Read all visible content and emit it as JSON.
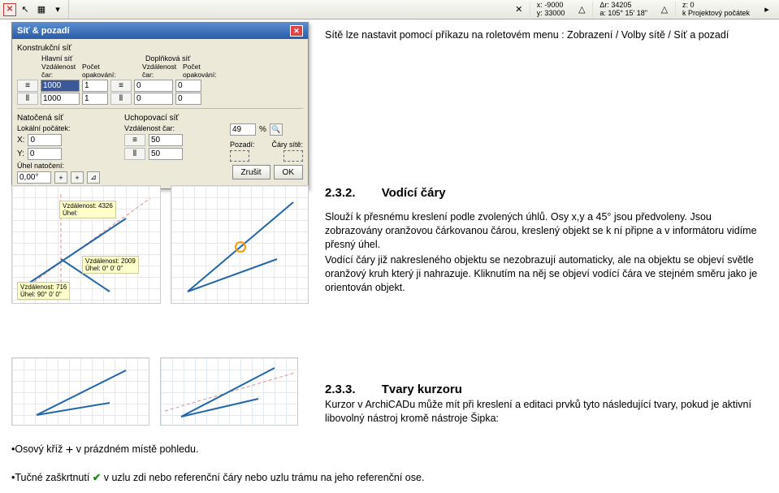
{
  "toolbar": {
    "x_label": "x:",
    "x_val": "-9000",
    "y_label": "y:",
    "y_val": "33000",
    "dr_label": "Δr:",
    "dr_val": "34205",
    "a_label": "a:",
    "a_val": "105° 15' 18\"",
    "z_label": "z:",
    "z_val": "0",
    "k_label": "k",
    "k_val": "Projektový počátek"
  },
  "dialog": {
    "title": "Síť & pozadí",
    "section_konstrukcni": "Konstrukční síť",
    "hdr_hlavni": "Hlavní síť",
    "hdr_doplnkova": "Doplňková síť",
    "lbl_vzdalenost": "Vzdálenost čar:",
    "lbl_pocet_op": "Počet opakování:",
    "lbl_pocet_op2": "Počet opakování:",
    "row1_v1": "1000",
    "row1_v2": "1",
    "row1_v3": "0",
    "row1_v4": "0",
    "row2_v1": "1000",
    "row2_v2": "1",
    "row2_v3": "0",
    "row2_v4": "0",
    "section_natocena": "Natočená síť",
    "section_uchop": "Uchopovací síť",
    "lbl_lokpoc": "Lokální počátek:",
    "lbl_vzdalcar": "Vzdálenost čar:",
    "lbl_x": "X:",
    "val_x": "0",
    "val_x2": "50",
    "lbl_y": "Y:",
    "val_y": "0",
    "val_y2": "50",
    "lbl_uhel": "Úhel natočení:",
    "val_uhel": "0,00°",
    "lbl_pct": "49",
    "pct": "%",
    "lbl_pozadi": "Pozadí:",
    "lbl_cary": "Čáry sítě:",
    "btn_zrusit": "Zrušit",
    "btn_ok": "OK"
  },
  "para1": "Sítě lze nastavit pomocí příkazu na roletovém menu : Zobrazení / Volby sítě / Síť a pozadí",
  "heading1_num": "2.3.2.",
  "heading1_txt": "Vodící čáry",
  "para2": "Slouží k přesnému kreslení podle zvolených úhlů. Osy x,y a 45° jsou předvoleny. Jsou zobrazovány oranžovou čárkovanou čárou, kreslený objekt se k ní připne a v informátoru vidíme přesný úhel.",
  "para3": "Vodící čáry již nakresleného objektu se nezobrazují automaticky, ale na objektu se objeví světle oranžový kruh který ji nahrazuje. Kliknutím na něj se objeví vodící čára ve stejném směru jako je orientován objekt.",
  "heading2_num": "2.3.3.",
  "heading2_txt": "Tvary kurzoru",
  "para4": "Kurzor v ArchiCADu může mít při kreslení a editaci prvků tyto následující tvary, pokud je aktivní libovolný nástroj kromě nástroje Šipka:",
  "bullet1_pre": "•Osový kříž ",
  "bullet1_post": " v prázdném místě pohledu.",
  "bullet2_pre": "•Tučné zaškrtnutí ",
  "bullet2_post": " v uzlu zdi nebo referenční čáry nebo uzlu trámu na jeho referenční ose.",
  "thumb1": {
    "dist": "Vzdálenost: 4326",
    "ang": "Úhel:"
  },
  "thumb2": {
    "dist": "Vzdálenost: 2009",
    "ang": "Úhel:      0° 0' 0\""
  },
  "thumb3": {
    "dist": "Vzdálenost: 716",
    "ang": "Úhel:    90° 0' 0\""
  }
}
